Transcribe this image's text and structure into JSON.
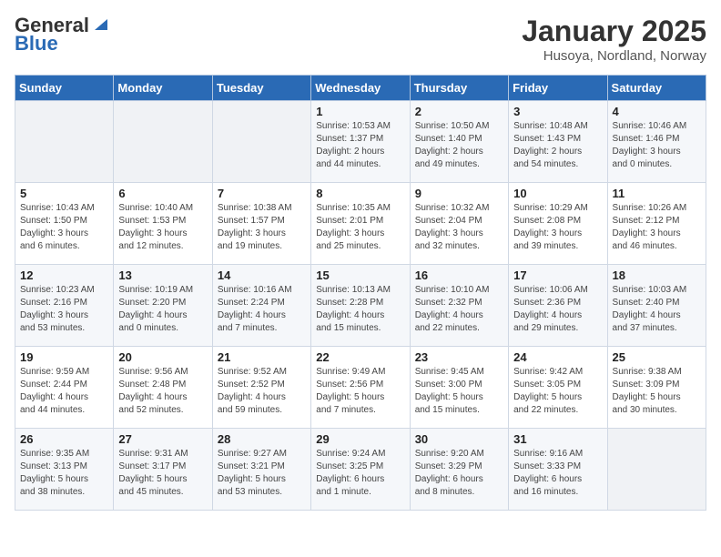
{
  "header": {
    "logo_line1": "General",
    "logo_line2": "Blue",
    "title": "January 2025",
    "subtitle": "Husoya, Nordland, Norway"
  },
  "days_of_week": [
    "Sunday",
    "Monday",
    "Tuesday",
    "Wednesday",
    "Thursday",
    "Friday",
    "Saturday"
  ],
  "weeks": [
    [
      {
        "day": "",
        "detail": ""
      },
      {
        "day": "",
        "detail": ""
      },
      {
        "day": "",
        "detail": ""
      },
      {
        "day": "1",
        "detail": "Sunrise: 10:53 AM\nSunset: 1:37 PM\nDaylight: 2 hours\nand 44 minutes."
      },
      {
        "day": "2",
        "detail": "Sunrise: 10:50 AM\nSunset: 1:40 PM\nDaylight: 2 hours\nand 49 minutes."
      },
      {
        "day": "3",
        "detail": "Sunrise: 10:48 AM\nSunset: 1:43 PM\nDaylight: 2 hours\nand 54 minutes."
      },
      {
        "day": "4",
        "detail": "Sunrise: 10:46 AM\nSunset: 1:46 PM\nDaylight: 3 hours\nand 0 minutes."
      }
    ],
    [
      {
        "day": "5",
        "detail": "Sunrise: 10:43 AM\nSunset: 1:50 PM\nDaylight: 3 hours\nand 6 minutes."
      },
      {
        "day": "6",
        "detail": "Sunrise: 10:40 AM\nSunset: 1:53 PM\nDaylight: 3 hours\nand 12 minutes."
      },
      {
        "day": "7",
        "detail": "Sunrise: 10:38 AM\nSunset: 1:57 PM\nDaylight: 3 hours\nand 19 minutes."
      },
      {
        "day": "8",
        "detail": "Sunrise: 10:35 AM\nSunset: 2:01 PM\nDaylight: 3 hours\nand 25 minutes."
      },
      {
        "day": "9",
        "detail": "Sunrise: 10:32 AM\nSunset: 2:04 PM\nDaylight: 3 hours\nand 32 minutes."
      },
      {
        "day": "10",
        "detail": "Sunrise: 10:29 AM\nSunset: 2:08 PM\nDaylight: 3 hours\nand 39 minutes."
      },
      {
        "day": "11",
        "detail": "Sunrise: 10:26 AM\nSunset: 2:12 PM\nDaylight: 3 hours\nand 46 minutes."
      }
    ],
    [
      {
        "day": "12",
        "detail": "Sunrise: 10:23 AM\nSunset: 2:16 PM\nDaylight: 3 hours\nand 53 minutes."
      },
      {
        "day": "13",
        "detail": "Sunrise: 10:19 AM\nSunset: 2:20 PM\nDaylight: 4 hours\nand 0 minutes."
      },
      {
        "day": "14",
        "detail": "Sunrise: 10:16 AM\nSunset: 2:24 PM\nDaylight: 4 hours\nand 7 minutes."
      },
      {
        "day": "15",
        "detail": "Sunrise: 10:13 AM\nSunset: 2:28 PM\nDaylight: 4 hours\nand 15 minutes."
      },
      {
        "day": "16",
        "detail": "Sunrise: 10:10 AM\nSunset: 2:32 PM\nDaylight: 4 hours\nand 22 minutes."
      },
      {
        "day": "17",
        "detail": "Sunrise: 10:06 AM\nSunset: 2:36 PM\nDaylight: 4 hours\nand 29 minutes."
      },
      {
        "day": "18",
        "detail": "Sunrise: 10:03 AM\nSunset: 2:40 PM\nDaylight: 4 hours\nand 37 minutes."
      }
    ],
    [
      {
        "day": "19",
        "detail": "Sunrise: 9:59 AM\nSunset: 2:44 PM\nDaylight: 4 hours\nand 44 minutes."
      },
      {
        "day": "20",
        "detail": "Sunrise: 9:56 AM\nSunset: 2:48 PM\nDaylight: 4 hours\nand 52 minutes."
      },
      {
        "day": "21",
        "detail": "Sunrise: 9:52 AM\nSunset: 2:52 PM\nDaylight: 4 hours\nand 59 minutes."
      },
      {
        "day": "22",
        "detail": "Sunrise: 9:49 AM\nSunset: 2:56 PM\nDaylight: 5 hours\nand 7 minutes."
      },
      {
        "day": "23",
        "detail": "Sunrise: 9:45 AM\nSunset: 3:00 PM\nDaylight: 5 hours\nand 15 minutes."
      },
      {
        "day": "24",
        "detail": "Sunrise: 9:42 AM\nSunset: 3:05 PM\nDaylight: 5 hours\nand 22 minutes."
      },
      {
        "day": "25",
        "detail": "Sunrise: 9:38 AM\nSunset: 3:09 PM\nDaylight: 5 hours\nand 30 minutes."
      }
    ],
    [
      {
        "day": "26",
        "detail": "Sunrise: 9:35 AM\nSunset: 3:13 PM\nDaylight: 5 hours\nand 38 minutes."
      },
      {
        "day": "27",
        "detail": "Sunrise: 9:31 AM\nSunset: 3:17 PM\nDaylight: 5 hours\nand 45 minutes."
      },
      {
        "day": "28",
        "detail": "Sunrise: 9:27 AM\nSunset: 3:21 PM\nDaylight: 5 hours\nand 53 minutes."
      },
      {
        "day": "29",
        "detail": "Sunrise: 9:24 AM\nSunset: 3:25 PM\nDaylight: 6 hours\nand 1 minute."
      },
      {
        "day": "30",
        "detail": "Sunrise: 9:20 AM\nSunset: 3:29 PM\nDaylight: 6 hours\nand 8 minutes."
      },
      {
        "day": "31",
        "detail": "Sunrise: 9:16 AM\nSunset: 3:33 PM\nDaylight: 6 hours\nand 16 minutes."
      },
      {
        "day": "",
        "detail": ""
      }
    ]
  ]
}
